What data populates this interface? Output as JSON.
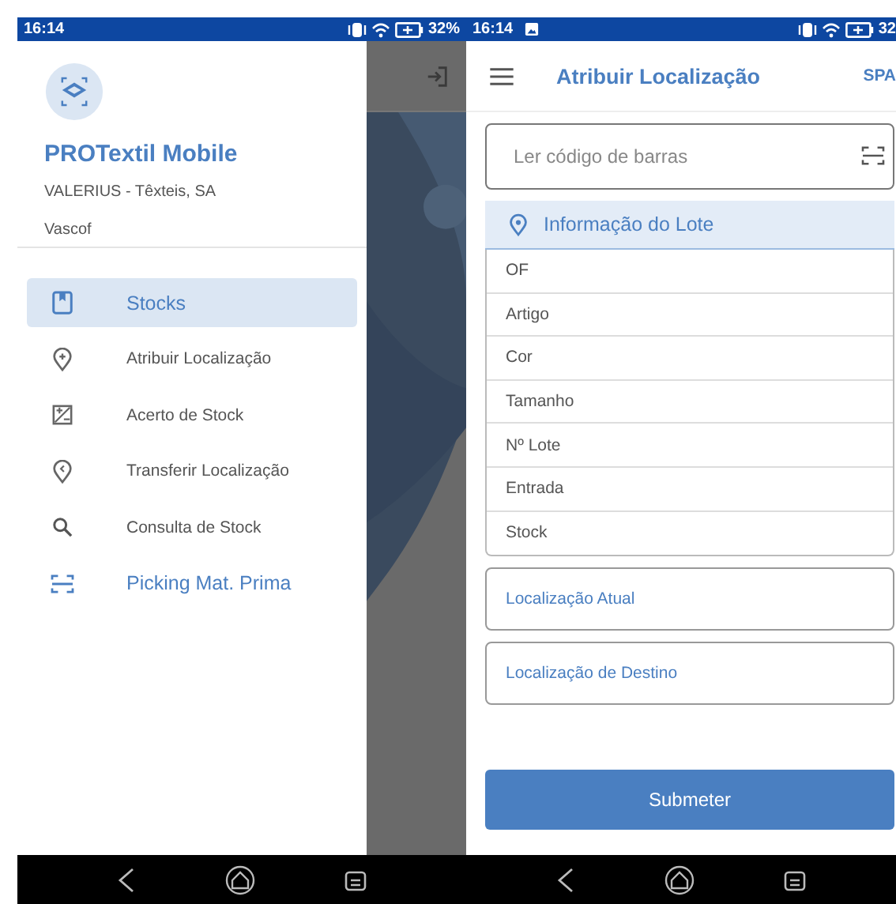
{
  "left_phone": {
    "status_bar": {
      "time": "16:14",
      "battery": "32%"
    },
    "drawer": {
      "app_name": "PROTextil Mobile",
      "company": "VALERIUS - Têxteis, SA",
      "user": "Vascof",
      "items": [
        {
          "label": "Stocks",
          "selected": true,
          "kind": "accent"
        },
        {
          "label": "Atribuir Localização",
          "selected": false,
          "kind": "plain"
        },
        {
          "label": "Acerto de Stock",
          "selected": false,
          "kind": "plain"
        },
        {
          "label": "Transferir Localização",
          "selected": false,
          "kind": "plain"
        },
        {
          "label": "Consulta de Stock",
          "selected": false,
          "kind": "plain"
        },
        {
          "label": "Picking Mat. Prima",
          "selected": false,
          "kind": "accent"
        }
      ]
    }
  },
  "right_phone": {
    "status_bar": {
      "time": "16:14",
      "battery": "32"
    },
    "app_bar": {
      "title": "Atribuir Localização",
      "action": "SPA"
    },
    "barcode_field": {
      "placeholder": "Ler código de barras"
    },
    "lot_info": {
      "title": "Informação do Lote",
      "fields": [
        "OF",
        "Artigo",
        "Cor",
        "Tamanho",
        "Nº Lote",
        "Entrada",
        "Stock"
      ]
    },
    "location_fields": [
      {
        "placeholder": "Localização Atual"
      },
      {
        "placeholder": "Localização de Destino"
      }
    ],
    "submit_button": "Submeter"
  }
}
